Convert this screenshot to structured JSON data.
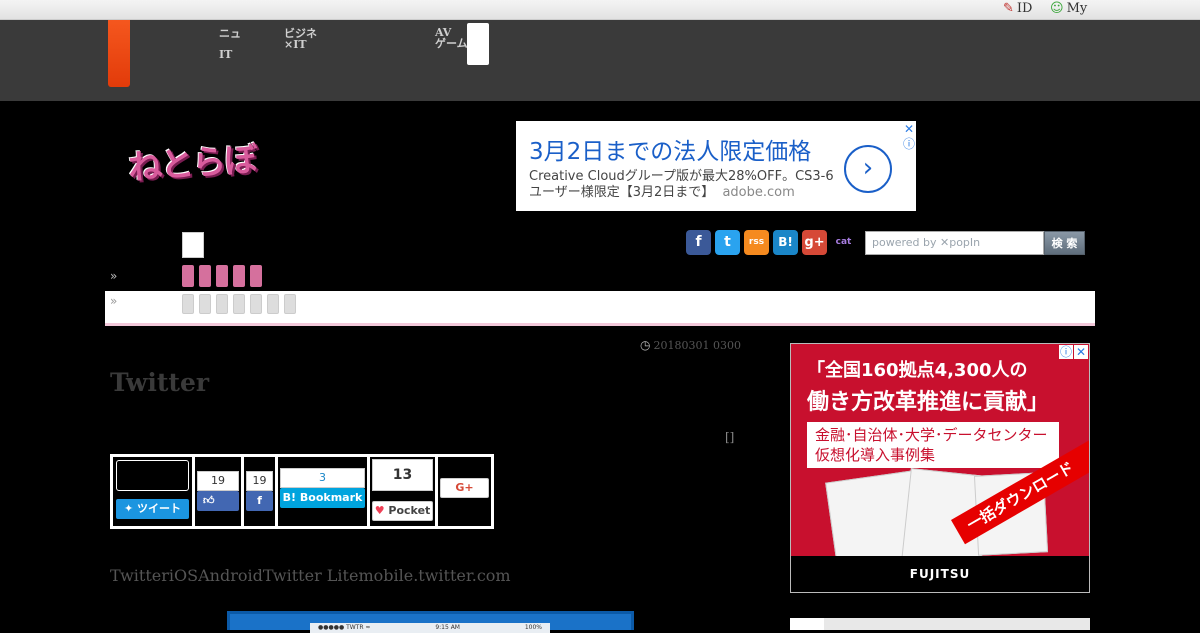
{
  "topbar": {
    "id_label": "ID",
    "my_label": "My"
  },
  "nav": {
    "item1_line1": "ニュ",
    "item1_line2": "IT",
    "item2_line1": "ビジネ",
    "item2_line2": "×IT",
    "item3_line1": "AV",
    "item3_line2": "ゲーム"
  },
  "logo": {
    "text": "ねとらぼ"
  },
  "ad_top": {
    "headline": "3月2日までの法人限定価格",
    "line1": "Creative Cloudグループ版が最大28%OFF。CS3-6",
    "line2": "ユーザー様限定【3月2日まで】",
    "domain": "adobe.com",
    "arrow": "›",
    "close": "✕",
    "info": "ⓘ"
  },
  "social": {
    "facebook": "f",
    "twitter": "t",
    "rss": "rss",
    "hatena": "B!",
    "gplus": "g+",
    "cat": "cat"
  },
  "search": {
    "placeholder": "powered by ✕popIn",
    "button": "検 索"
  },
  "breadcrumb": {
    "chev1": "»",
    "chev2": "»"
  },
  "article": {
    "date": "20180301 0300",
    "title": "Twitter",
    "bracket": "[]",
    "lead": "TwitteriOSAndroidTwitter Litemobile.twitter.com"
  },
  "share": {
    "tweet_label": "ツイート",
    "fb_like_count": "19",
    "fb_share_count": "19",
    "hatena_count": "3",
    "hatena_label": "B! Bookmark",
    "pocket_count": "13",
    "pocket_label": "Pocket",
    "gplus_label": "G+"
  },
  "phone": {
    "carrier": "●●●●● TWTR ≈",
    "time": "9:15 AM",
    "battery": "100%"
  },
  "ad_side": {
    "headline1": "「全国160拠点4,300人の",
    "headline2": "働き方改革推進に貢献」",
    "box_line1": "金融･自治体･大学･データセンター",
    "box_line2": "仮想化導入事例集",
    "ribbon": "一括ダウンロード",
    "brand": "FUJITSU",
    "info": "ⓘ",
    "close": "✕"
  },
  "colors": {
    "accent": "#e8470f",
    "logo_pink": "#d85b9c",
    "ad_blue": "#1a5fc8",
    "side_red": "#c8102e"
  }
}
